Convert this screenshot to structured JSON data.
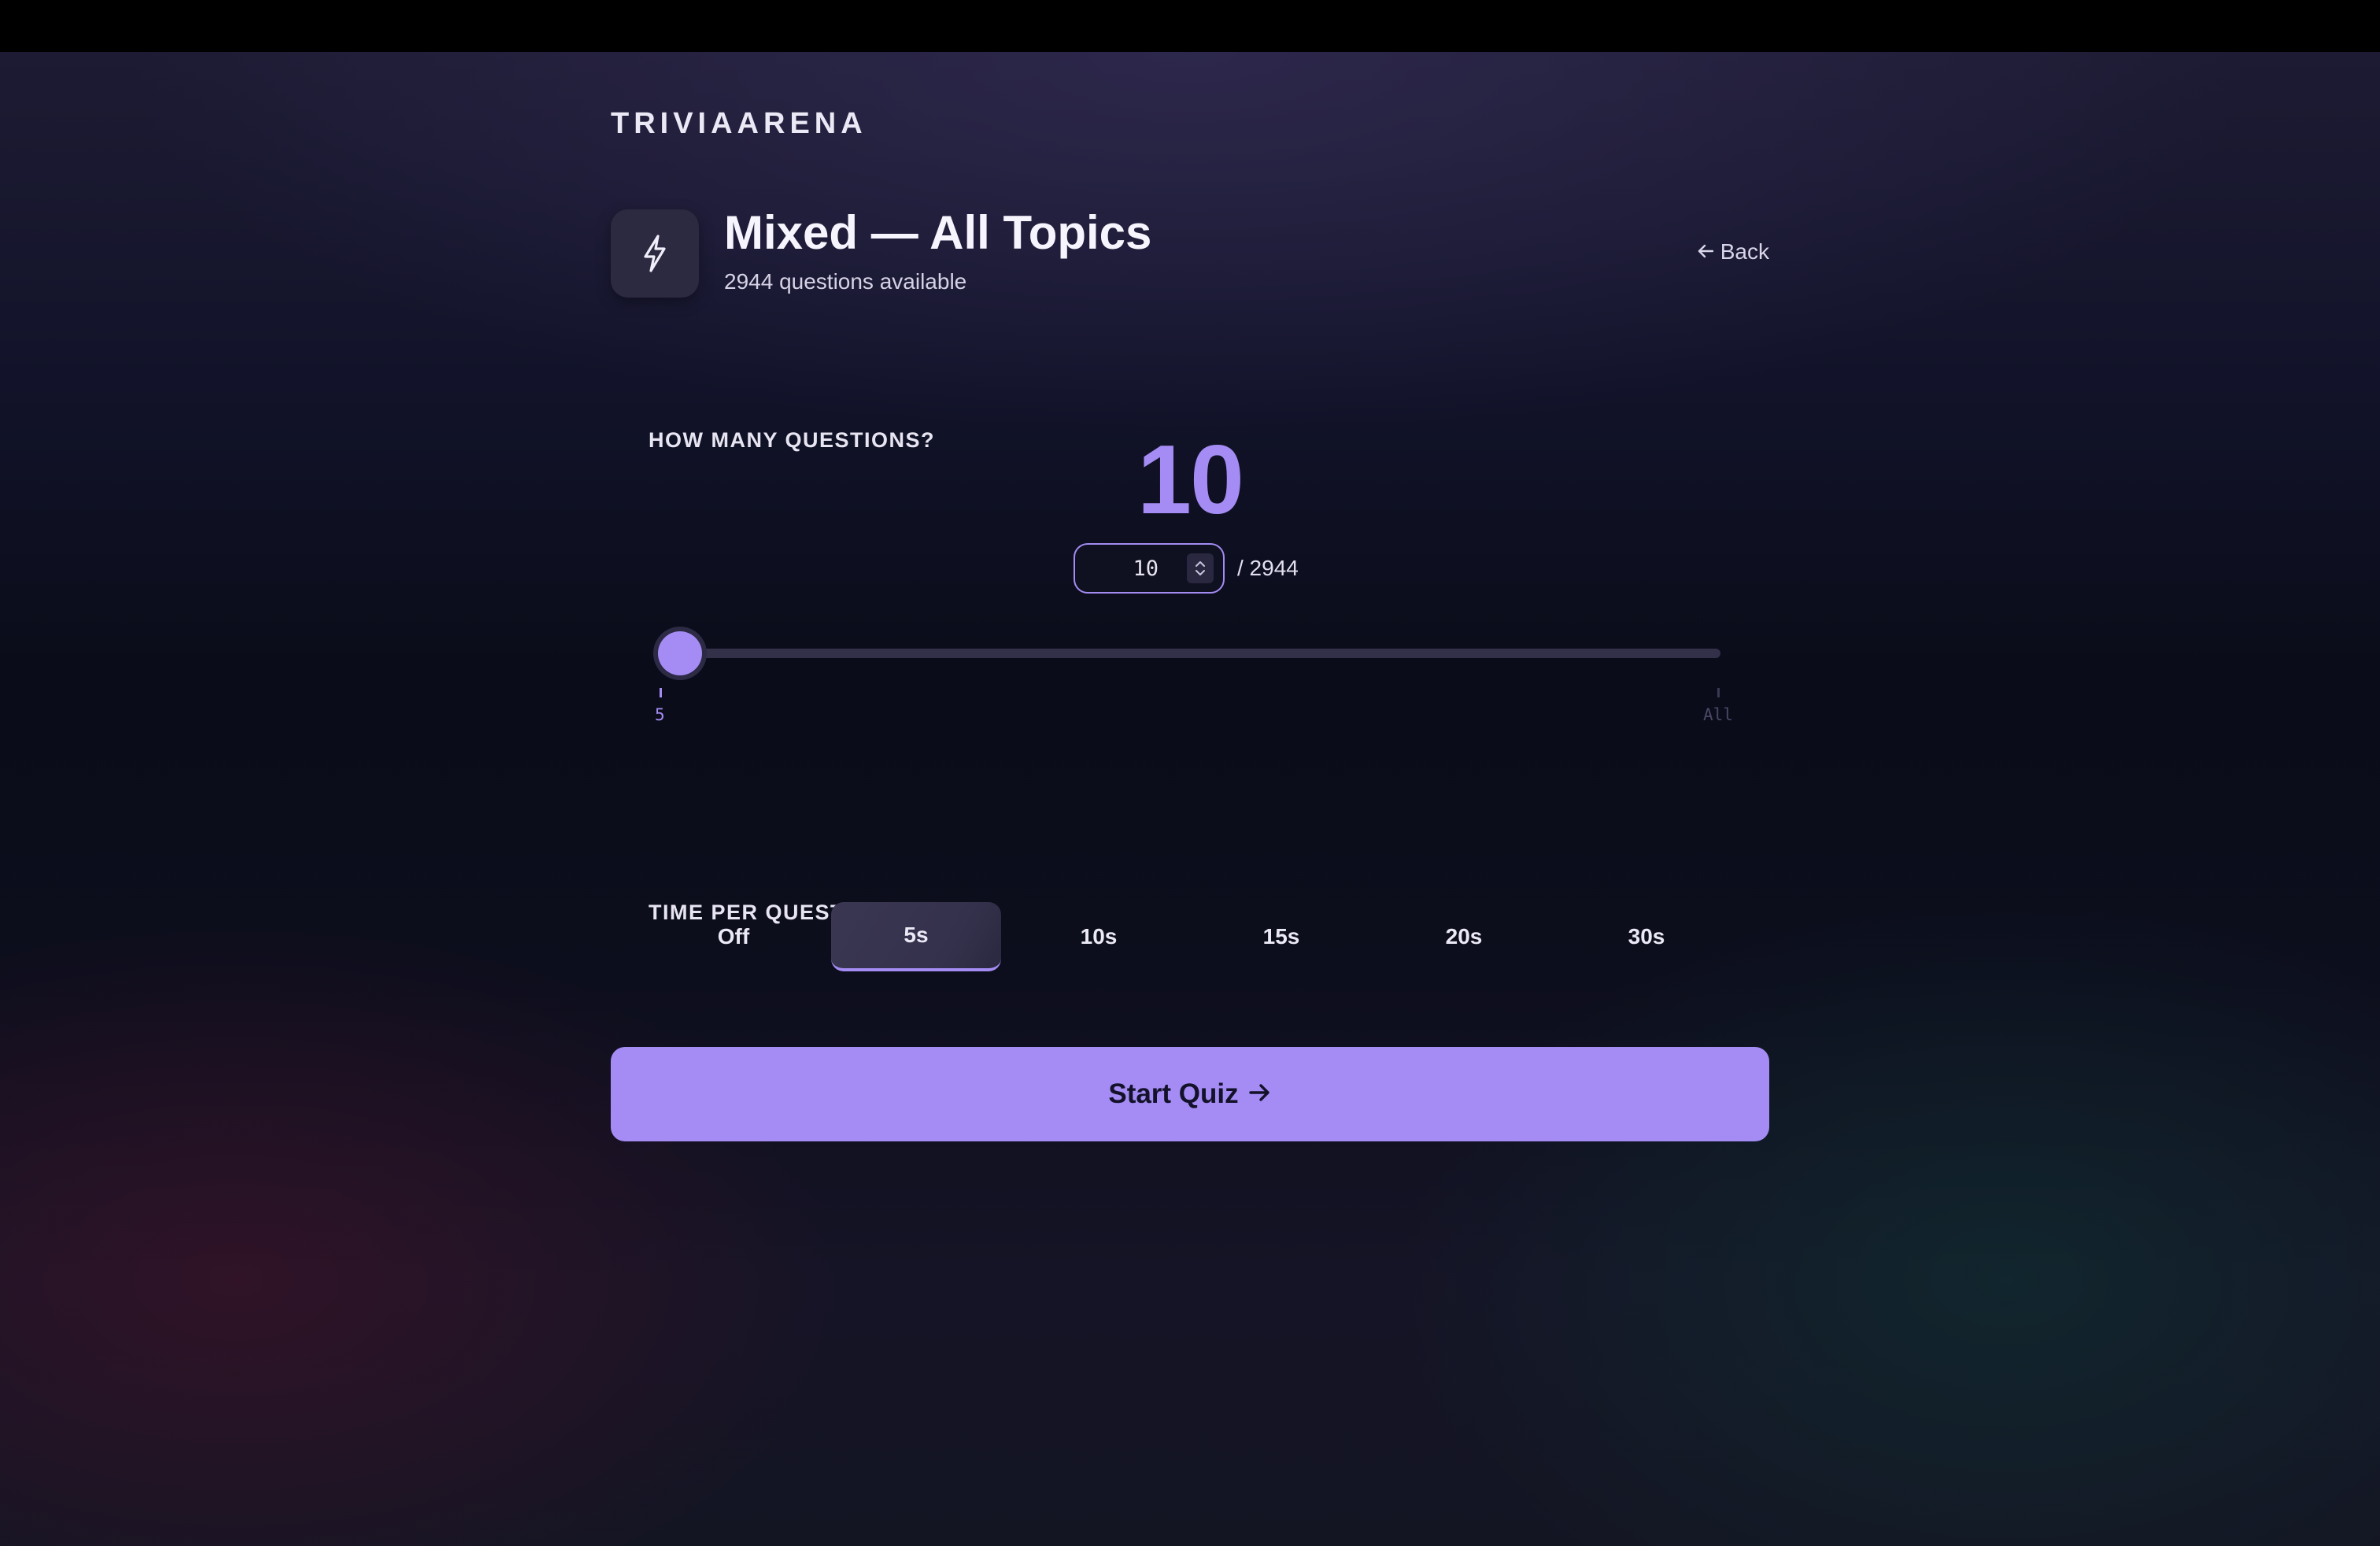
{
  "app": {
    "brand": "TRIVIAARENA"
  },
  "category": {
    "icon": "lightning-icon",
    "title": "Mixed — All Topics",
    "subtitle": "2944 questions available"
  },
  "back": {
    "icon": "arrow-left-icon",
    "label": "Back"
  },
  "question_count": {
    "label": "HOW MANY QUESTIONS?",
    "value_display": "10",
    "input_value": "10",
    "total_label": "/ 2944",
    "slider": {
      "min": 5,
      "max": 2944,
      "value": 10,
      "min_label": "5",
      "max_label": "All"
    }
  },
  "time_per_question": {
    "label": "TIME PER QUESTION",
    "options": [
      "Off",
      "5s",
      "10s",
      "15s",
      "20s",
      "30s"
    ],
    "selected": "5s"
  },
  "start_button": {
    "label": "Start Quiz",
    "icon": "arrow-right-icon"
  },
  "colors": {
    "accent": "#a48cf4",
    "background": "#0c0d1a",
    "button_text": "#14122a"
  }
}
